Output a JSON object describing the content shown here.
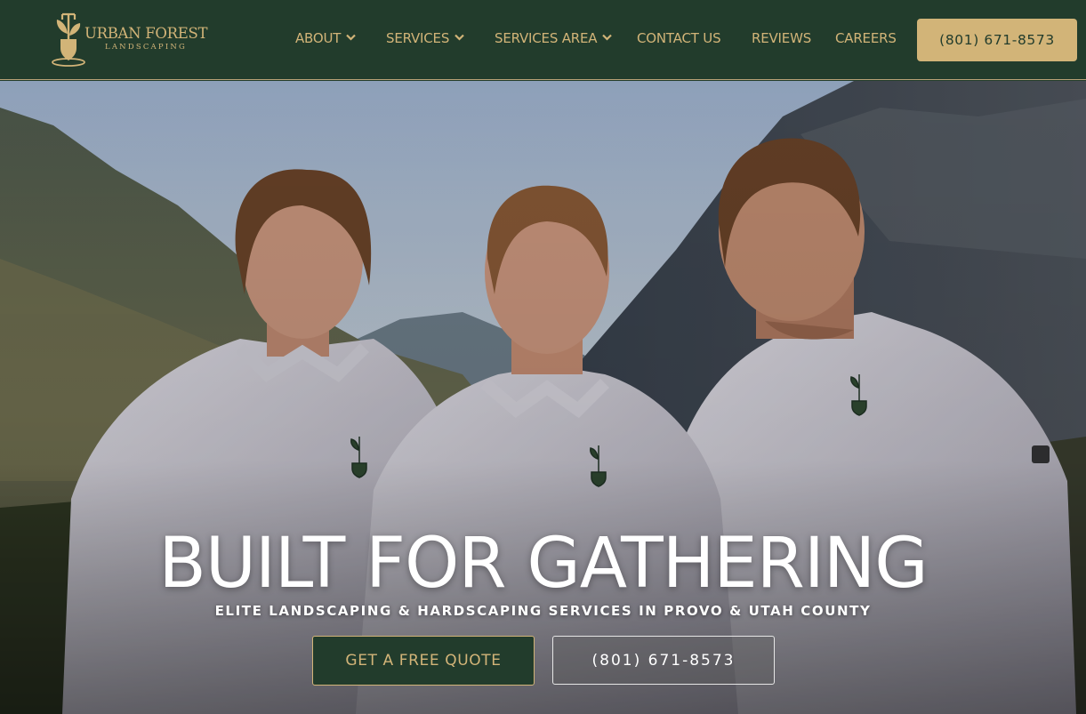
{
  "header": {
    "logo": {
      "line1": "URBAN FOREST",
      "line2": "LANDSCAPING"
    },
    "nav": [
      {
        "label": "ABOUT",
        "has_dropdown": true
      },
      {
        "label": "SERVICES",
        "has_dropdown": true
      },
      {
        "label": "SERVICES AREA",
        "has_dropdown": true
      },
      {
        "label": "CONTACT US",
        "has_dropdown": false
      },
      {
        "label": "REVIEWS",
        "has_dropdown": false
      },
      {
        "label": "CAREERS",
        "has_dropdown": false
      }
    ],
    "phone_button": "(801) 671-8573"
  },
  "hero": {
    "title": "BUILT FOR GATHERING",
    "subtitle": "ELITE LANDSCAPING & HARDSCAPING SERVICES IN PROVO & UTAH COUNTY",
    "quote_button": "GET A FREE QUOTE",
    "phone_button": "(801) 671-8573"
  },
  "colors": {
    "brand_green": "#223c2c",
    "brand_gold": "#d2b478",
    "white": "#ffffff"
  },
  "icons": {
    "logo": "shovel-plant-icon",
    "dropdown": "chevron-down-icon",
    "shirt_logo": "shovel-plant-icon"
  }
}
